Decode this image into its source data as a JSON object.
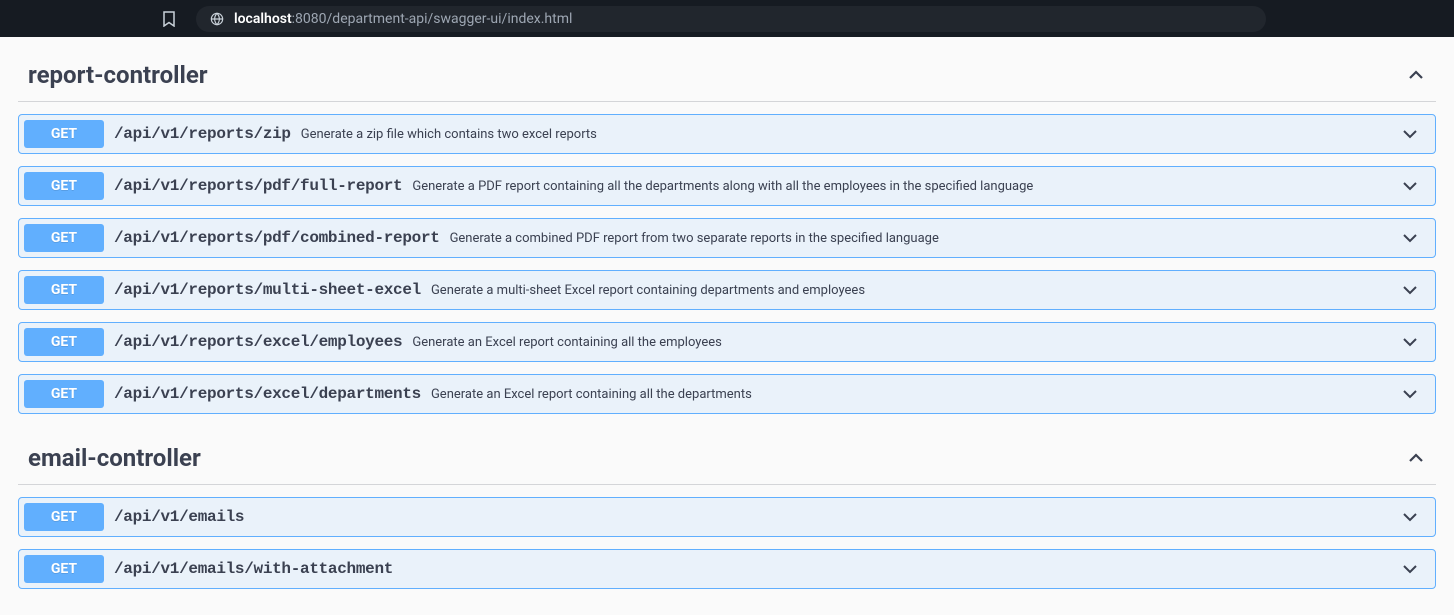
{
  "browser": {
    "url_host": "localhost",
    "url_rest": ":8080/department-api/swagger-ui/index.html"
  },
  "sections": [
    {
      "name": "report-controller",
      "endpoints": [
        {
          "method": "GET",
          "path": "/api/v1/reports/zip",
          "desc": "Generate a zip file which contains two excel reports"
        },
        {
          "method": "GET",
          "path": "/api/v1/reports/pdf/full-report",
          "desc": "Generate a PDF report containing all the departments along with all the employees in the specified language"
        },
        {
          "method": "GET",
          "path": "/api/v1/reports/pdf/combined-report",
          "desc": "Generate a combined PDF report from two separate reports in the specified language"
        },
        {
          "method": "GET",
          "path": "/api/v1/reports/multi-sheet-excel",
          "desc": "Generate a multi-sheet Excel report containing departments and employees"
        },
        {
          "method": "GET",
          "path": "/api/v1/reports/excel/employees",
          "desc": "Generate an Excel report containing all the employees"
        },
        {
          "method": "GET",
          "path": "/api/v1/reports/excel/departments",
          "desc": "Generate an Excel report containing all the departments"
        }
      ]
    },
    {
      "name": "email-controller",
      "endpoints": [
        {
          "method": "GET",
          "path": "/api/v1/emails",
          "desc": ""
        },
        {
          "method": "GET",
          "path": "/api/v1/emails/with-attachment",
          "desc": ""
        }
      ]
    }
  ]
}
